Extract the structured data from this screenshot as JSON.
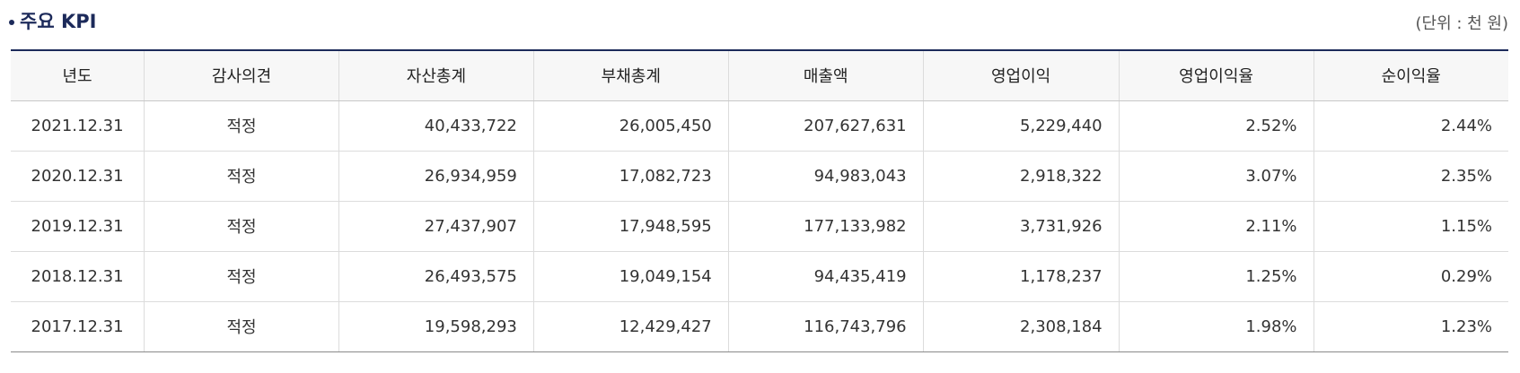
{
  "section": {
    "title": "주요 KPI",
    "unit": "(단위 : 천 원)"
  },
  "table": {
    "headers": [
      "년도",
      "감사의견",
      "자산총계",
      "부채총계",
      "매출액",
      "영업이익",
      "영업이익율",
      "순이익율"
    ],
    "rows": [
      [
        "2021.12.31",
        "적정",
        "40,433,722",
        "26,005,450",
        "207,627,631",
        "5,229,440",
        "2.52%",
        "2.44%"
      ],
      [
        "2020.12.31",
        "적정",
        "26,934,959",
        "17,082,723",
        "94,983,043",
        "2,918,322",
        "3.07%",
        "2.35%"
      ],
      [
        "2019.12.31",
        "적정",
        "27,437,907",
        "17,948,595",
        "177,133,982",
        "3,731,926",
        "2.11%",
        "1.15%"
      ],
      [
        "2018.12.31",
        "적정",
        "26,493,575",
        "19,049,154",
        "94,435,419",
        "1,178,237",
        "1.25%",
        "0.29%"
      ],
      [
        "2017.12.31",
        "적정",
        "19,598,293",
        "12,429,427",
        "116,743,796",
        "2,308,184",
        "1.98%",
        "1.23%"
      ]
    ]
  },
  "colors": {
    "accent": "#1c2a5a",
    "header_bg": "#f7f7f7",
    "border": "#dcdcdc"
  }
}
